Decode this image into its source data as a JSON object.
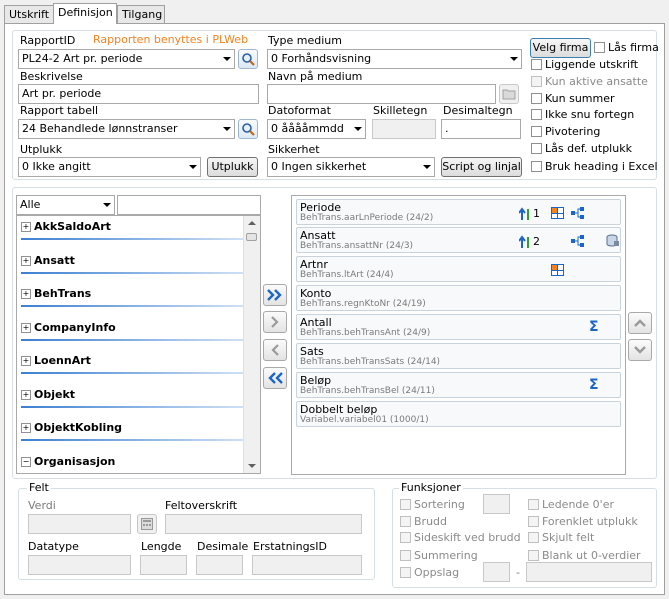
{
  "tabs": [
    "Utskrift",
    "Definisjon",
    "Tilgang"
  ],
  "header": {
    "rapport_id_label": "RapportID",
    "notice": "Rapporten benyttes i PLWeb",
    "rapport_id_value": "PL24-2 Art pr. periode",
    "beskrivelse_label": "Beskrivelse",
    "beskrivelse_value": "Art pr. periode",
    "rapport_tabell_label": "Rapport tabell",
    "rapport_tabell_value": "24 Behandlede lønnstranser",
    "utplukk_label": "Utplukk",
    "utplukk_value": "0 Ikke angitt",
    "utplukk_button": "Utplukk",
    "type_medium_label": "Type medium",
    "type_medium_value": "0 Forhåndsvisning",
    "navn_medium_label": "Navn på medium",
    "datoformat_label": "Datoformat",
    "datoformat_value": "0 ååååmmdd",
    "skilletegn_label": "Skilletegn",
    "desimaltegn_label": "Desimaltegn",
    "desimaltegn_value": ".",
    "sikkerhet_label": "Sikkerhet",
    "sikkerhet_value": "0 Ingen sikkerhet",
    "script_button": "Script og linjal",
    "velg_firma_button": "Velg firma",
    "options": [
      {
        "label": "Lås firma",
        "disabled": false
      },
      {
        "label": "Liggende utskrift",
        "disabled": false
      },
      {
        "label": "Kun aktive ansatte",
        "disabled": true
      },
      {
        "label": "Kun summer",
        "disabled": false
      },
      {
        "label": "Ikke snu fortegn",
        "disabled": false
      },
      {
        "label": "Pivotering",
        "disabled": false
      },
      {
        "label": "Lås def. utplukk",
        "disabled": false
      },
      {
        "label": "Bruk heading i Excel",
        "disabled": false
      }
    ]
  },
  "filter": {
    "value": "Alle"
  },
  "tree": [
    {
      "label": "AkkSaldoArt",
      "sign": "+"
    },
    {
      "label": "Ansatt",
      "sign": "+"
    },
    {
      "label": "BehTrans",
      "sign": "+"
    },
    {
      "label": "CompanyInfo",
      "sign": "+"
    },
    {
      "label": "LoennArt",
      "sign": "+"
    },
    {
      "label": "Objekt",
      "sign": "+"
    },
    {
      "label": "ObjektKobling",
      "sign": "+"
    },
    {
      "label": "Organisasjon",
      "sign": "−"
    }
  ],
  "fields": [
    {
      "title": "Periode",
      "sub": "BehTrans.aarLnPeriode (24/2)",
      "sort": "1",
      "icons": [
        "sort",
        "grid",
        "tree"
      ]
    },
    {
      "title": "Ansatt",
      "sub": "BehTrans.ansattNr (24/3)",
      "sort": "2",
      "icons": [
        "sort",
        "tree",
        "db"
      ]
    },
    {
      "title": "Artnr",
      "sub": "BehTrans.ltArt (24/4)",
      "sort": "",
      "icons": [
        "grid"
      ]
    },
    {
      "title": "Konto",
      "sub": "BehTrans.regnKtoNr (24/19)",
      "sort": "",
      "icons": []
    },
    {
      "title": "Antall",
      "sub": "BehTrans.behTransAnt (24/9)",
      "sort": "",
      "icons": [
        "sum"
      ]
    },
    {
      "title": "Sats",
      "sub": "BehTrans.behTransSats (24/14)",
      "sort": "",
      "icons": []
    },
    {
      "title": "Beløp",
      "sub": "BehTrans.behTransBel (24/11)",
      "sort": "",
      "icons": [
        "sum"
      ]
    },
    {
      "title": "Dobbelt beløp",
      "sub": "Variabel.variabel01 (1000/1)",
      "sort": "",
      "icons": []
    }
  ],
  "felt": {
    "legend": "Felt",
    "verdi_label": "Verdi",
    "feltoverskrift_label": "Feltoverskrift",
    "datatype_label": "Datatype",
    "lengde_label": "Lengde",
    "desimale_label": "Desimale",
    "erstatnings_label": "ErstatningsID"
  },
  "funksjoner": {
    "legend": "Funksjoner",
    "left": [
      "Sortering",
      "Brudd",
      "Sideskift ved brudd",
      "Summering",
      "Oppslag"
    ],
    "right": [
      "Ledende 0'er",
      "Forenklet utplukk",
      "Skjult felt",
      "Blank ut 0-verdier"
    ],
    "dash": "-"
  },
  "colors": {
    "notice": "#f58220",
    "accent": "#1a66c8",
    "underline": "#3c7fd0"
  }
}
